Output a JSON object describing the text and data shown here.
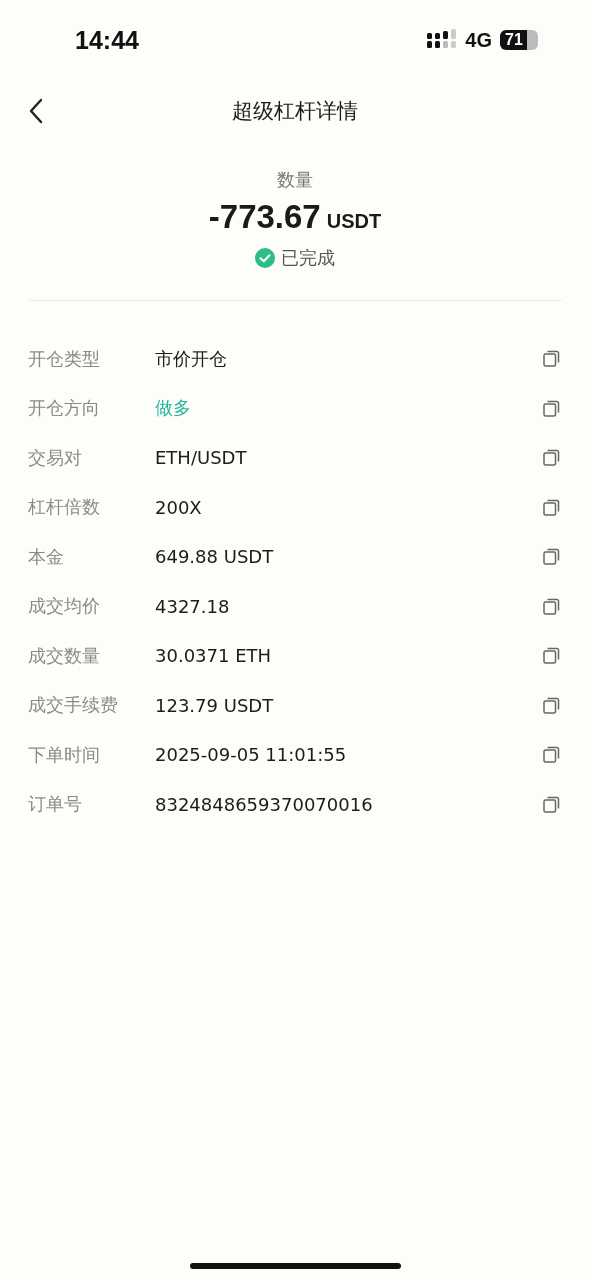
{
  "status_bar": {
    "time": "14:44",
    "network": "4G",
    "battery": "71"
  },
  "nav": {
    "title": "超级杠杆详情"
  },
  "summary": {
    "label": "数量",
    "amount": "-773.67",
    "unit": "USDT",
    "status": "已完成"
  },
  "rows": [
    {
      "label": "开仓类型",
      "value": "市价开仓",
      "kind": "plain"
    },
    {
      "label": "开仓方向",
      "value": "做多",
      "kind": "long"
    },
    {
      "label": "交易对",
      "value": "ETH/USDT",
      "kind": "plain"
    },
    {
      "label": "杠杆倍数",
      "value": "200X",
      "kind": "plain"
    },
    {
      "label": "本金",
      "value": "649.88 USDT",
      "kind": "plain"
    },
    {
      "label": "成交均价",
      "value": "4327.18",
      "kind": "plain"
    },
    {
      "label": "成交数量",
      "value": "30.0371 ETH",
      "kind": "plain"
    },
    {
      "label": "成交手续费",
      "value": "123.79 USDT",
      "kind": "plain"
    },
    {
      "label": "下单时间",
      "value": "2025-09-05 11:01:55",
      "kind": "plain"
    },
    {
      "label": "订单号",
      "value": "8324848659370070016",
      "kind": "plain"
    }
  ]
}
